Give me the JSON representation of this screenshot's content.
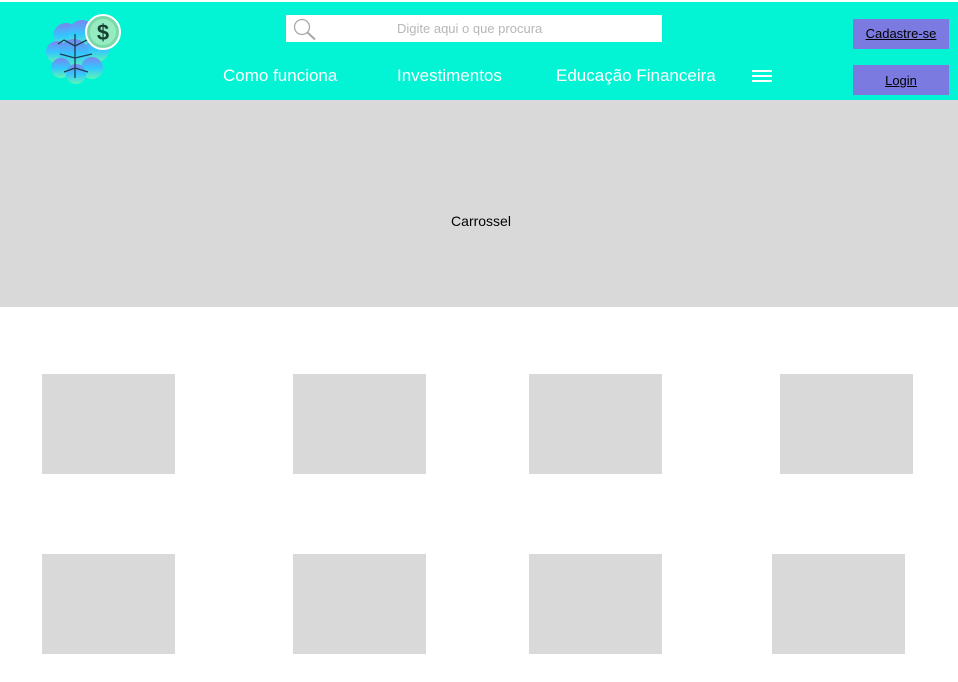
{
  "header": {
    "logo_icon": "brain-dollar-logo",
    "search": {
      "placeholder": "Digite aqui o que procura",
      "icon": "search-icon"
    },
    "nav": [
      {
        "label": "Como funciona"
      },
      {
        "label": "Investimentos"
      },
      {
        "label": "Educação Financeira"
      }
    ],
    "menu_icon": "hamburger-menu-icon",
    "signup_label": "Cadastre-se",
    "login_label": "Login"
  },
  "carousel": {
    "label": "Carrossel"
  },
  "colors": {
    "header_bg": "#03F4D5",
    "button_bg": "#7A7AE0",
    "placeholder_bg": "#D9D9D9"
  }
}
